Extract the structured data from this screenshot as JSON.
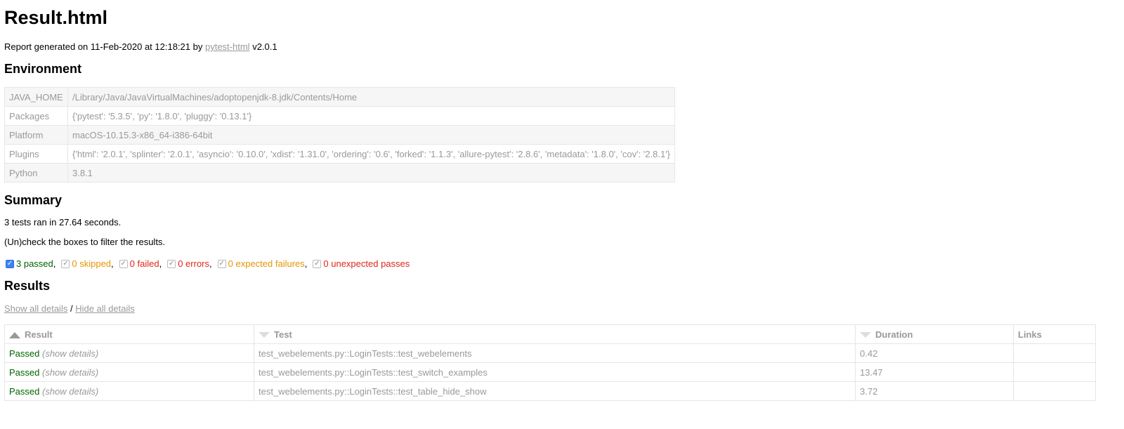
{
  "title": "Result.html",
  "meta": {
    "prefix": "Report generated on 11-Feb-2020 at 12:18:21 by",
    "link": "pytest-html",
    "suffix": "v2.0.1"
  },
  "environment": {
    "heading": "Environment",
    "rows": [
      {
        "key": "JAVA_HOME",
        "value": "/Library/Java/JavaVirtualMachines/adoptopenjdk-8.jdk/Contents/Home"
      },
      {
        "key": "Packages",
        "value": "{'pytest': '5.3.5', 'py': '1.8.0', 'pluggy': '0.13.1'}"
      },
      {
        "key": "Platform",
        "value": "macOS-10.15.3-x86_64-i386-64bit"
      },
      {
        "key": "Plugins",
        "value": "{'html': '2.0.1', 'splinter': '2.0.1', 'asyncio': '0.10.0', 'xdist': '1.31.0', 'ordering': '0.6', 'forked': '1.1.3', 'allure-pytest': '2.8.6', 'metadata': '1.8.0', 'cov': '2.8.1'}"
      },
      {
        "key": "Python",
        "value": "3.8.1"
      }
    ]
  },
  "summary": {
    "heading": "Summary",
    "ran_text": "3 tests ran in 27.64 seconds.",
    "filter_hint": "(Un)check the boxes to filter the results.",
    "filters": [
      {
        "label": "3 passed",
        "checked": true,
        "color": "#006400"
      },
      {
        "label": "0 skipped",
        "checked": true,
        "color": "#e69500"
      },
      {
        "label": "0 failed",
        "checked": true,
        "color": "#e0251a"
      },
      {
        "label": "0 errors",
        "checked": true,
        "color": "#e0251a"
      },
      {
        "label": "0 expected failures",
        "checked": true,
        "color": "#e69500"
      },
      {
        "label": "0 unexpected passes",
        "checked": true,
        "color": "#e0251a"
      }
    ]
  },
  "results": {
    "heading": "Results",
    "show_all": "Show all details",
    "divider": "/",
    "hide_all": "Hide all details",
    "columns": [
      "Result",
      "Test",
      "Duration",
      "Links"
    ],
    "rows": [
      {
        "result": "Passed",
        "details": "(show details)",
        "test": "test_webelements.py::LoginTests::test_webelements",
        "duration": "0.42",
        "links": ""
      },
      {
        "result": "Passed",
        "details": "(show details)",
        "test": "test_webelements.py::LoginTests::test_switch_examples",
        "duration": "13.47",
        "links": ""
      },
      {
        "result": "Passed",
        "details": "(show details)",
        "test": "test_webelements.py::LoginTests::test_table_hide_show",
        "duration": "3.72",
        "links": ""
      }
    ]
  }
}
